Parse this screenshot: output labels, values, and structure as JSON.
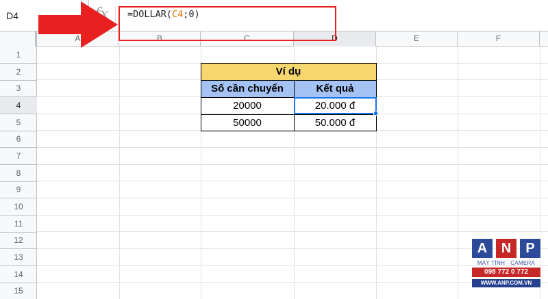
{
  "name_box": {
    "value": "D4"
  },
  "formula_bar": {
    "fx_label": "fx",
    "prefix": "=DOLLAR(",
    "ref": "C4",
    "sep": ";",
    "arg": "0",
    "suffix": ")"
  },
  "columns": [
    "A",
    "B",
    "C",
    "D",
    "E",
    "F"
  ],
  "rows": [
    "1",
    "2",
    "3",
    "4",
    "5",
    "6",
    "7",
    "8",
    "9",
    "10",
    "11",
    "12",
    "13",
    "14",
    "15"
  ],
  "table": {
    "title": "Ví dụ",
    "headers": [
      "Số cần chuyển",
      "Kết quả"
    ],
    "data": [
      [
        "20000",
        "20.000 đ"
      ],
      [
        "50000",
        "50.000 đ"
      ]
    ]
  },
  "logo": {
    "letters": [
      "A",
      "N",
      "P"
    ],
    "subtitle": "MÁY TÍNH - CAMERA",
    "phone": "098 772 0 772",
    "website": "WWW.ANP.COM.VN",
    "colors": {
      "square1": "#2c4a9a",
      "square2": "#c62828",
      "square3": "#2c4a9a"
    }
  },
  "colors": {
    "accent": "#1a73e8",
    "highlight_box": "#e8201f",
    "arrow": "#e8201f",
    "title_fill": "#f6d66e",
    "header_fill": "#a4c2f4"
  }
}
